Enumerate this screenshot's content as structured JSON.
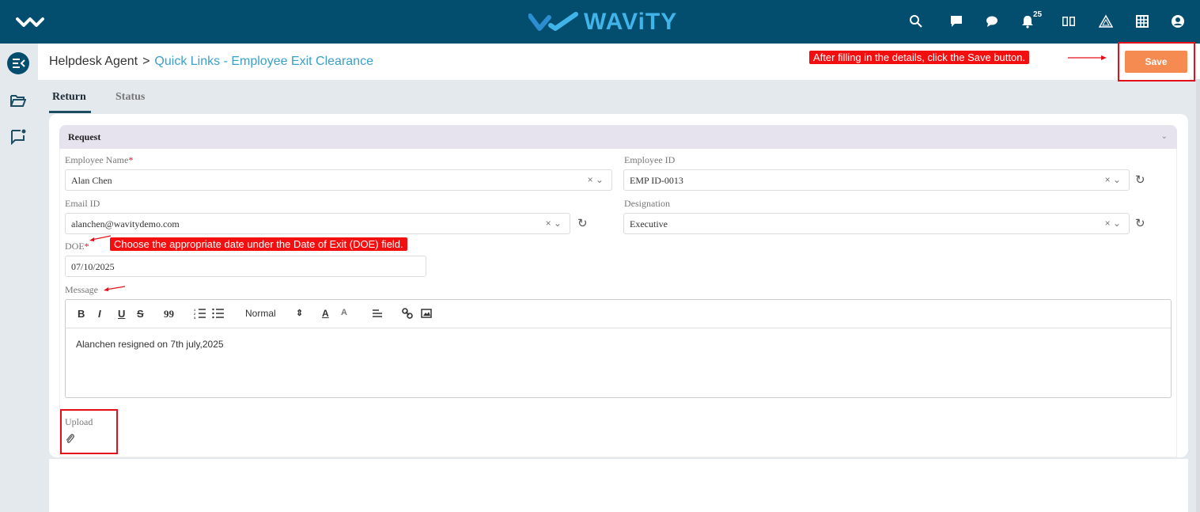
{
  "app": {
    "brand": "WAViTY",
    "notification_count": "25",
    "icons": [
      "menu-logo-icon",
      "search-icon",
      "chat-icon",
      "message-icon",
      "bell-icon",
      "book-icon",
      "alert-triangle-icon",
      "grid-icon",
      "user-icon"
    ]
  },
  "breadcrumb": {
    "parent": "Helpdesk Agent",
    "separator": ">",
    "current": "Quick Links - Employee Exit Clearance"
  },
  "save_label": "Save",
  "tabs": [
    {
      "label": "Return",
      "active": true
    },
    {
      "label": "Status",
      "active": false
    }
  ],
  "section": {
    "title": "Request"
  },
  "fields": {
    "employee_name": {
      "label": "Employee Name",
      "required": "*",
      "value": "Alan Chen"
    },
    "employee_id": {
      "label": "Employee ID",
      "value": "EMP ID-0013"
    },
    "email_id": {
      "label": "Email ID",
      "value": "alanchen@wavitydemo.com"
    },
    "designation": {
      "label": "Designation",
      "value": "Executive"
    },
    "doe": {
      "label": "DOE",
      "required": "*",
      "value": "07/10/2025"
    },
    "message": {
      "label": "Message"
    },
    "upload": {
      "label": "Upload"
    }
  },
  "editor": {
    "toolbar": {
      "bold": "B",
      "italic": "I",
      "underline": "U",
      "strike": "S",
      "quote": "99",
      "heading": "Normal"
    },
    "content": "Alanchen resigned on 7th july,2025"
  },
  "annotations": {
    "save_hint": "After filling in the details, click the Save button.",
    "doe_hint": "Choose the appropriate date under the Date of Exit (DOE) field."
  },
  "colors": {
    "topbar": "#034d6f",
    "accent": "#3a9fc9",
    "save": "#f68b52",
    "annotation": "#f30f0f"
  }
}
